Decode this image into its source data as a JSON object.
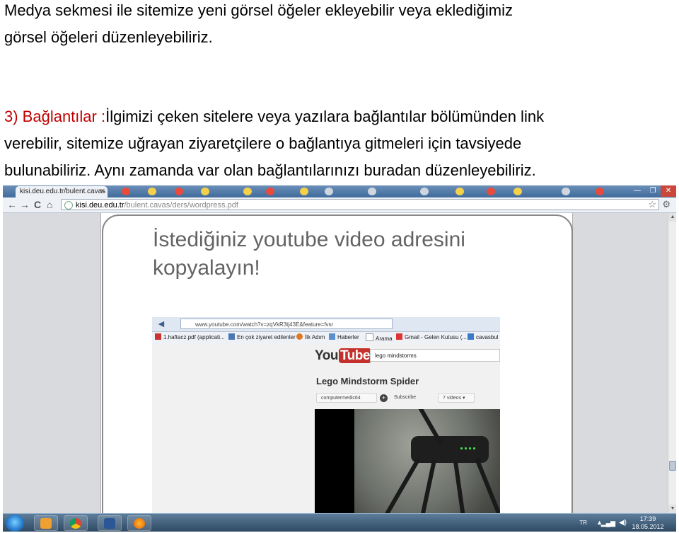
{
  "document": {
    "intro": {
      "line1": "Medya sekmesi ile sitemize yeni görsel öğeler ekleyebilir veya eklediğimiz",
      "line2": "görsel öğeleri düzenleyebiliriz."
    },
    "section3": {
      "heading": "3) Bağlantılar :",
      "line1_rest": "İlgimizi çeken sitelere veya yazılara bağlantılar bölümünden link",
      "line2": "verebilir, sitemize uğrayan ziyaretçilere o bağlantıya gitmeleri için tavsiyede",
      "line3": "bulunabiliriz. Aynı zamanda var olan bağlantılarınızı buradan düzenleyebiliriz."
    }
  },
  "screenshot": {
    "browser": {
      "tab_title": "kisi.deu.edu.tr/bulent.cavas",
      "tab_close": "×",
      "window_buttons": [
        "—",
        "❐",
        "✕"
      ],
      "url_host": "kisi.deu.edu.tr",
      "url_path": "/bulent.cavas/ders/wordpress.pdf",
      "back": "←",
      "forward": "→",
      "reload": "C",
      "home": "⌂",
      "star": "☆",
      "wrench": "⚙"
    },
    "slide": {
      "title_line1": "İstediğiniz youtube video adresini",
      "title_line2": "kopyalayın!"
    },
    "inner_browser": {
      "url": "www.youtube.com/watch?v=zqVkR3tj43E&feature=fvsr",
      "bookmarks": [
        "1.haftacz.pdf (applicati...",
        "En çok ziyaret edilenler",
        "İlk Adım",
        "Haberler",
        "Arama",
        "Gmail - Gelen Kutusu (...",
        "cavasbul"
      ],
      "youtube": {
        "logo_you": "You",
        "logo_tube": "Tube",
        "search_value": "lego mindstorms",
        "video_title": "Lego Mindstorm Spider",
        "channel": "computermedic64",
        "subscribe": "Subscribe",
        "videos": "7 videos ▾"
      }
    },
    "taskbar": {
      "language": "TR",
      "time": "17:39",
      "date": "18.05.2012"
    }
  }
}
